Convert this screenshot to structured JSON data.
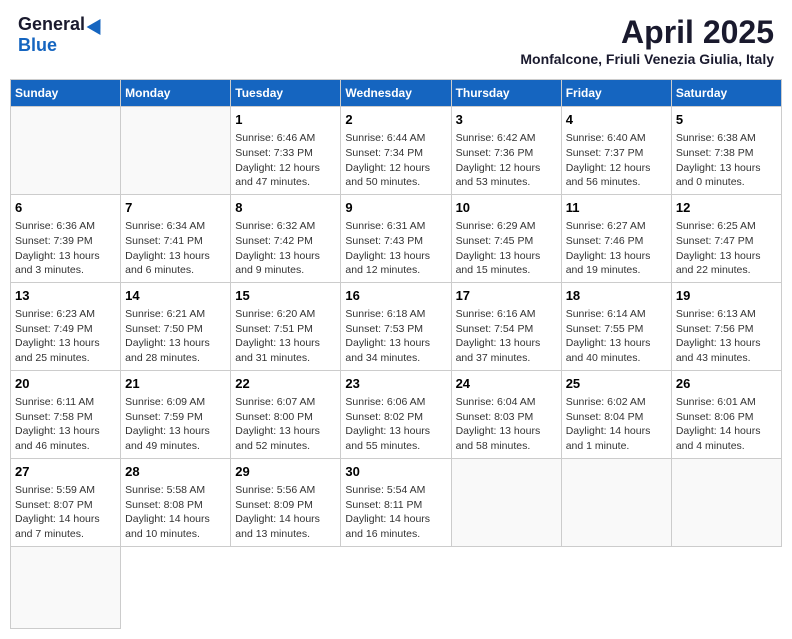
{
  "header": {
    "logo_general": "General",
    "logo_blue": "Blue",
    "title": "April 2025",
    "location": "Monfalcone, Friuli Venezia Giulia, Italy"
  },
  "weekdays": [
    "Sunday",
    "Monday",
    "Tuesday",
    "Wednesday",
    "Thursday",
    "Friday",
    "Saturday"
  ],
  "days": [
    {
      "date": null,
      "info": null
    },
    {
      "date": null,
      "info": null
    },
    {
      "date": "1",
      "info": "Sunrise: 6:46 AM\nSunset: 7:33 PM\nDaylight: 12 hours and 47 minutes."
    },
    {
      "date": "2",
      "info": "Sunrise: 6:44 AM\nSunset: 7:34 PM\nDaylight: 12 hours and 50 minutes."
    },
    {
      "date": "3",
      "info": "Sunrise: 6:42 AM\nSunset: 7:36 PM\nDaylight: 12 hours and 53 minutes."
    },
    {
      "date": "4",
      "info": "Sunrise: 6:40 AM\nSunset: 7:37 PM\nDaylight: 12 hours and 56 minutes."
    },
    {
      "date": "5",
      "info": "Sunrise: 6:38 AM\nSunset: 7:38 PM\nDaylight: 13 hours and 0 minutes."
    },
    {
      "date": "6",
      "info": "Sunrise: 6:36 AM\nSunset: 7:39 PM\nDaylight: 13 hours and 3 minutes."
    },
    {
      "date": "7",
      "info": "Sunrise: 6:34 AM\nSunset: 7:41 PM\nDaylight: 13 hours and 6 minutes."
    },
    {
      "date": "8",
      "info": "Sunrise: 6:32 AM\nSunset: 7:42 PM\nDaylight: 13 hours and 9 minutes."
    },
    {
      "date": "9",
      "info": "Sunrise: 6:31 AM\nSunset: 7:43 PM\nDaylight: 13 hours and 12 minutes."
    },
    {
      "date": "10",
      "info": "Sunrise: 6:29 AM\nSunset: 7:45 PM\nDaylight: 13 hours and 15 minutes."
    },
    {
      "date": "11",
      "info": "Sunrise: 6:27 AM\nSunset: 7:46 PM\nDaylight: 13 hours and 19 minutes."
    },
    {
      "date": "12",
      "info": "Sunrise: 6:25 AM\nSunset: 7:47 PM\nDaylight: 13 hours and 22 minutes."
    },
    {
      "date": "13",
      "info": "Sunrise: 6:23 AM\nSunset: 7:49 PM\nDaylight: 13 hours and 25 minutes."
    },
    {
      "date": "14",
      "info": "Sunrise: 6:21 AM\nSunset: 7:50 PM\nDaylight: 13 hours and 28 minutes."
    },
    {
      "date": "15",
      "info": "Sunrise: 6:20 AM\nSunset: 7:51 PM\nDaylight: 13 hours and 31 minutes."
    },
    {
      "date": "16",
      "info": "Sunrise: 6:18 AM\nSunset: 7:53 PM\nDaylight: 13 hours and 34 minutes."
    },
    {
      "date": "17",
      "info": "Sunrise: 6:16 AM\nSunset: 7:54 PM\nDaylight: 13 hours and 37 minutes."
    },
    {
      "date": "18",
      "info": "Sunrise: 6:14 AM\nSunset: 7:55 PM\nDaylight: 13 hours and 40 minutes."
    },
    {
      "date": "19",
      "info": "Sunrise: 6:13 AM\nSunset: 7:56 PM\nDaylight: 13 hours and 43 minutes."
    },
    {
      "date": "20",
      "info": "Sunrise: 6:11 AM\nSunset: 7:58 PM\nDaylight: 13 hours and 46 minutes."
    },
    {
      "date": "21",
      "info": "Sunrise: 6:09 AM\nSunset: 7:59 PM\nDaylight: 13 hours and 49 minutes."
    },
    {
      "date": "22",
      "info": "Sunrise: 6:07 AM\nSunset: 8:00 PM\nDaylight: 13 hours and 52 minutes."
    },
    {
      "date": "23",
      "info": "Sunrise: 6:06 AM\nSunset: 8:02 PM\nDaylight: 13 hours and 55 minutes."
    },
    {
      "date": "24",
      "info": "Sunrise: 6:04 AM\nSunset: 8:03 PM\nDaylight: 13 hours and 58 minutes."
    },
    {
      "date": "25",
      "info": "Sunrise: 6:02 AM\nSunset: 8:04 PM\nDaylight: 14 hours and 1 minute."
    },
    {
      "date": "26",
      "info": "Sunrise: 6:01 AM\nSunset: 8:06 PM\nDaylight: 14 hours and 4 minutes."
    },
    {
      "date": "27",
      "info": "Sunrise: 5:59 AM\nSunset: 8:07 PM\nDaylight: 14 hours and 7 minutes."
    },
    {
      "date": "28",
      "info": "Sunrise: 5:58 AM\nSunset: 8:08 PM\nDaylight: 14 hours and 10 minutes."
    },
    {
      "date": "29",
      "info": "Sunrise: 5:56 AM\nSunset: 8:09 PM\nDaylight: 14 hours and 13 minutes."
    },
    {
      "date": "30",
      "info": "Sunrise: 5:54 AM\nSunset: 8:11 PM\nDaylight: 14 hours and 16 minutes."
    },
    {
      "date": null,
      "info": null
    },
    {
      "date": null,
      "info": null
    },
    {
      "date": null,
      "info": null
    },
    {
      "date": null,
      "info": null
    }
  ]
}
